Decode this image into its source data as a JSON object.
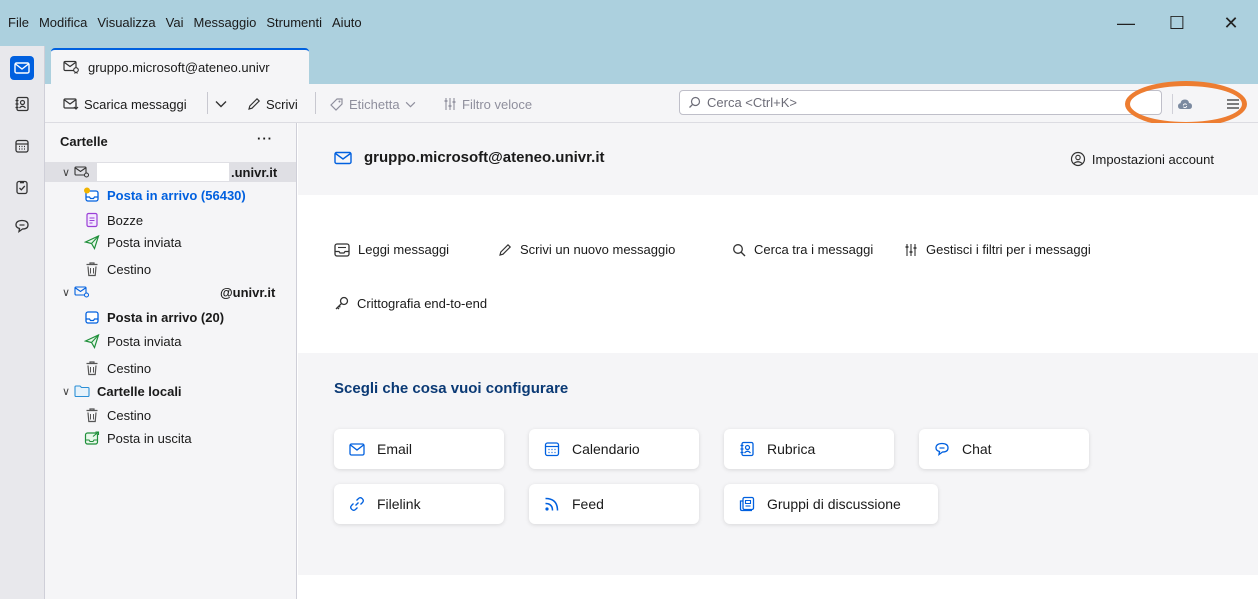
{
  "menu": [
    "File",
    "Modifica",
    "Visualizza",
    "Vai",
    "Messaggio",
    "Strumenti",
    "Aiuto"
  ],
  "window_controls": {
    "minimize": "—",
    "maximize": "☐",
    "close": "✕"
  },
  "tab": {
    "label": "gruppo.microsoft@ateneo.univr"
  },
  "toolbar": {
    "get_messages": "Scarica messaggi",
    "write": "Scrivi",
    "tag": "Etichetta",
    "quick_filter": "Filtro veloce",
    "search_placeholder": "Cerca <Ctrl+K>"
  },
  "folder_pane": {
    "header": "Cartelle",
    "more": "···",
    "account1": {
      "name_suffix": ".univr.it",
      "folders": [
        "Posta in arrivo (56430)",
        "Bozze",
        "Posta inviata",
        "Cestino"
      ]
    },
    "account2": {
      "name_suffix": "@univr.it",
      "folders": [
        "Posta in arrivo (20)",
        "Posta inviata",
        "Cestino"
      ]
    },
    "local": {
      "name": "Cartelle locali",
      "folders": [
        "Cestino",
        "Posta in uscita"
      ]
    }
  },
  "account_central": {
    "title": "gruppo.microsoft@ateneo.univr.it",
    "settings": "Impostazioni account",
    "actions": [
      "Leggi messaggi",
      "Scrivi un nuovo messaggio",
      "Cerca tra i messaggi",
      "Gestisci i filtri per i messaggi",
      "Crittografia end-to-end"
    ],
    "setup_title": "Scegli che cosa vuoi configurare",
    "setup_cards": [
      "Email",
      "Calendario",
      "Rubrica",
      "Chat",
      "Filelink",
      "Feed",
      "Gruppi di discussione"
    ]
  },
  "colors": {
    "accent": "#0060df",
    "titlebar": "#acd0de",
    "annotation": "#ed7d31"
  }
}
